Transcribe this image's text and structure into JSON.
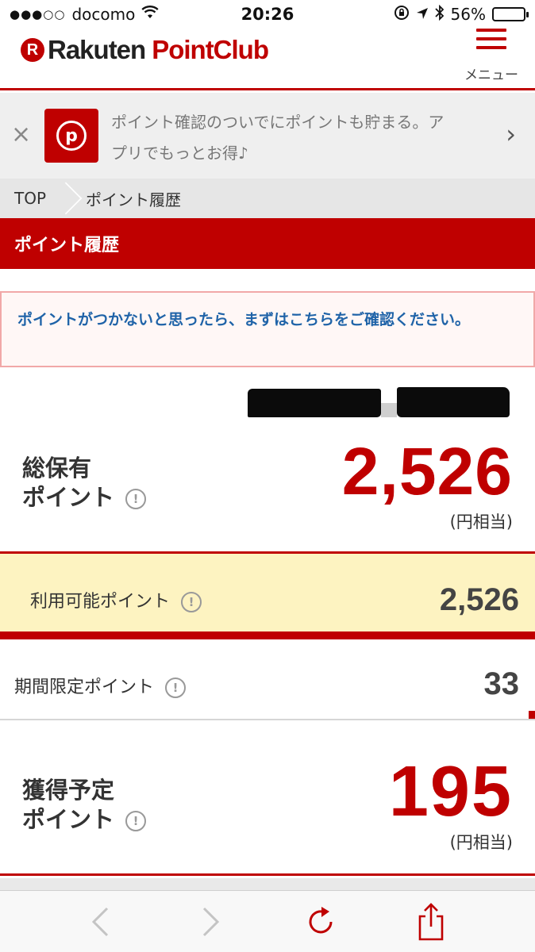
{
  "status_bar": {
    "carrier": "docomo",
    "time": "20:26",
    "battery": "56%",
    "battery_level": 0.56
  },
  "header": {
    "logo_mark": "R",
    "logo_rakuten": "Rakuten",
    "logo_pointclub": "PointClub",
    "menu_label": "メニュー"
  },
  "app_banner": {
    "close": "×",
    "icon_letter": "p",
    "text": "ポイント確認のついでにポイントも貯まる。アプリでもっとお得♪",
    "arrow": "›"
  },
  "breadcrumb": {
    "top": "TOP",
    "current": "ポイント履歴"
  },
  "page_title": "ポイント履歴",
  "notice": {
    "text": "ポイントがつかないと思ったら、まずはこちらをご確認ください。"
  },
  "total": {
    "label_line1": "総保有",
    "label_line2": "ポイント",
    "value": "2,526",
    "unit": "(円相当)"
  },
  "usable": {
    "label": "利用可能ポイント",
    "value": "2,526"
  },
  "limited": {
    "label": "期間限定ポイント",
    "value": "33"
  },
  "expected": {
    "label_line1": "獲得予定",
    "label_line2": "ポイント",
    "value": "195",
    "unit": "(円相当)"
  },
  "info_glyph": "!",
  "toolbar": {
    "icons": [
      "back-icon",
      "forward-icon",
      "reload-icon",
      "share-icon"
    ]
  },
  "colors": {
    "brand_red": "#bf0000",
    "notice_link": "#1f63a8",
    "usable_bg": "#fdf3c1"
  }
}
